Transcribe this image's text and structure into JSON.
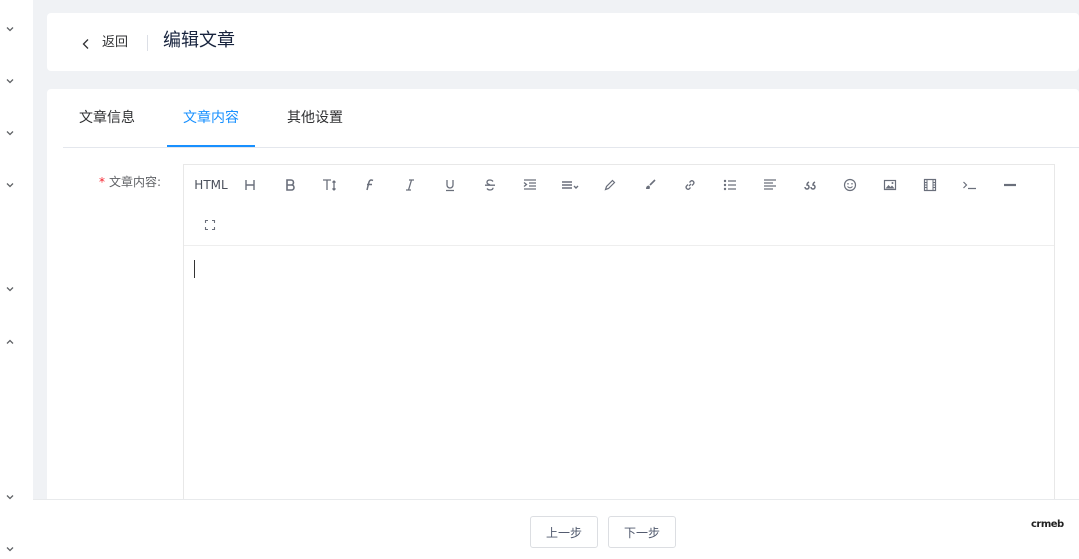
{
  "header": {
    "back_label": "返回",
    "title": "编辑文章"
  },
  "tabs": [
    {
      "label": "文章信息",
      "active": false
    },
    {
      "label": "文章内容",
      "active": true
    },
    {
      "label": "其他设置",
      "active": false
    }
  ],
  "form": {
    "required_mark": "*",
    "content_label": "文章内容:"
  },
  "editor": {
    "toolbar": [
      "html",
      "heading-icon",
      "bold-icon",
      "font-size-icon",
      "font-family-icon",
      "italic-icon",
      "underline-icon",
      "strikethrough-icon",
      "indent-icon",
      "line-height-icon",
      "text-color-icon",
      "background-color-icon",
      "link-icon",
      "unordered-list-icon",
      "align-icon",
      "quote-icon",
      "emoji-icon",
      "image-icon",
      "video-icon",
      "code-icon",
      "horizontal-rule-icon",
      "fullscreen-icon"
    ],
    "html_label": "HTML",
    "content": ""
  },
  "footer": {
    "prev_label": "上一步",
    "next_label": "下一步",
    "logo_text": "crmeb"
  },
  "colors": {
    "accent": "#1890ff",
    "required": "#f5222d",
    "background": "#f0f2f5"
  }
}
